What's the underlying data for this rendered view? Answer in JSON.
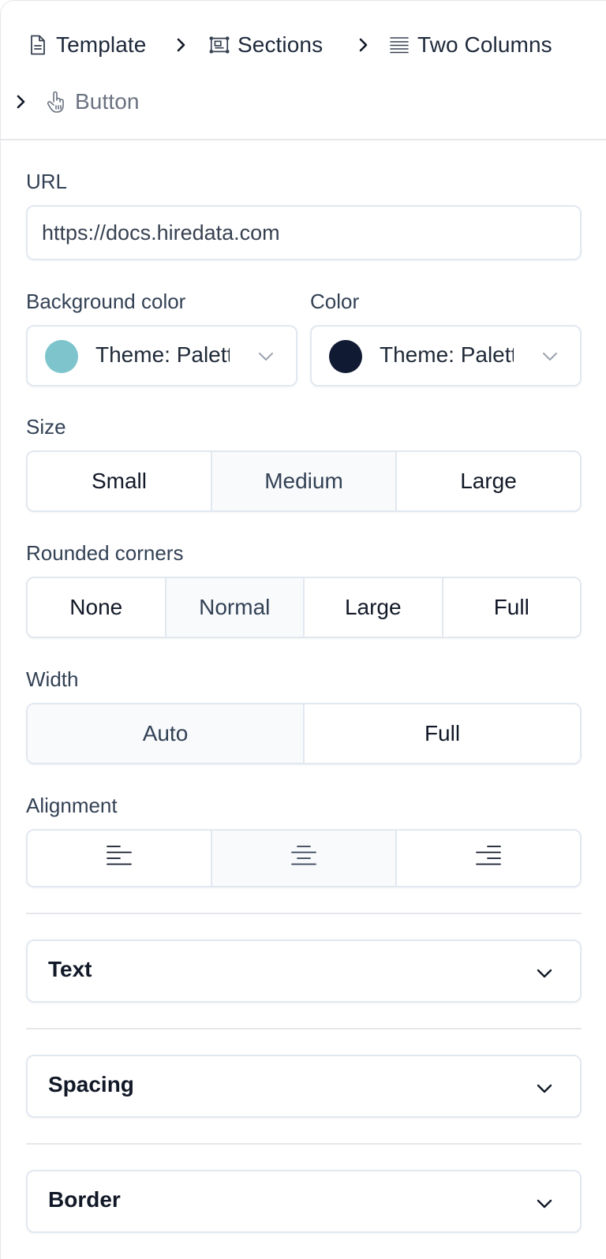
{
  "breadcrumb": [
    {
      "label": "Template",
      "icon": "document-icon"
    },
    {
      "label": "Sections",
      "icon": "sections-icon"
    },
    {
      "label": "Two Columns",
      "icon": "lines-icon"
    },
    {
      "label": "Button",
      "icon": "pointer-hand-icon"
    }
  ],
  "url": {
    "label": "URL",
    "value": "https://docs.hiredata.com"
  },
  "background_color": {
    "label": "Background color",
    "value": "Theme: Palette",
    "swatch": "#7dc4cc"
  },
  "color": {
    "label": "Color",
    "value": "Theme: Palette",
    "swatch": "#111a33"
  },
  "size": {
    "label": "Size",
    "options": [
      "Small",
      "Medium",
      "Large"
    ],
    "selected": "Medium"
  },
  "rounded_corners": {
    "label": "Rounded corners",
    "options": [
      "None",
      "Normal",
      "Large",
      "Full"
    ],
    "selected": "Normal"
  },
  "width": {
    "label": "Width",
    "options": [
      "Auto",
      "Full"
    ],
    "selected": "Auto"
  },
  "alignment": {
    "label": "Alignment",
    "options": [
      "align-left-icon",
      "align-center-icon",
      "align-right-icon"
    ],
    "selected": "align-center-icon"
  },
  "panels": [
    {
      "title": "Text"
    },
    {
      "title": "Spacing"
    },
    {
      "title": "Border"
    }
  ]
}
